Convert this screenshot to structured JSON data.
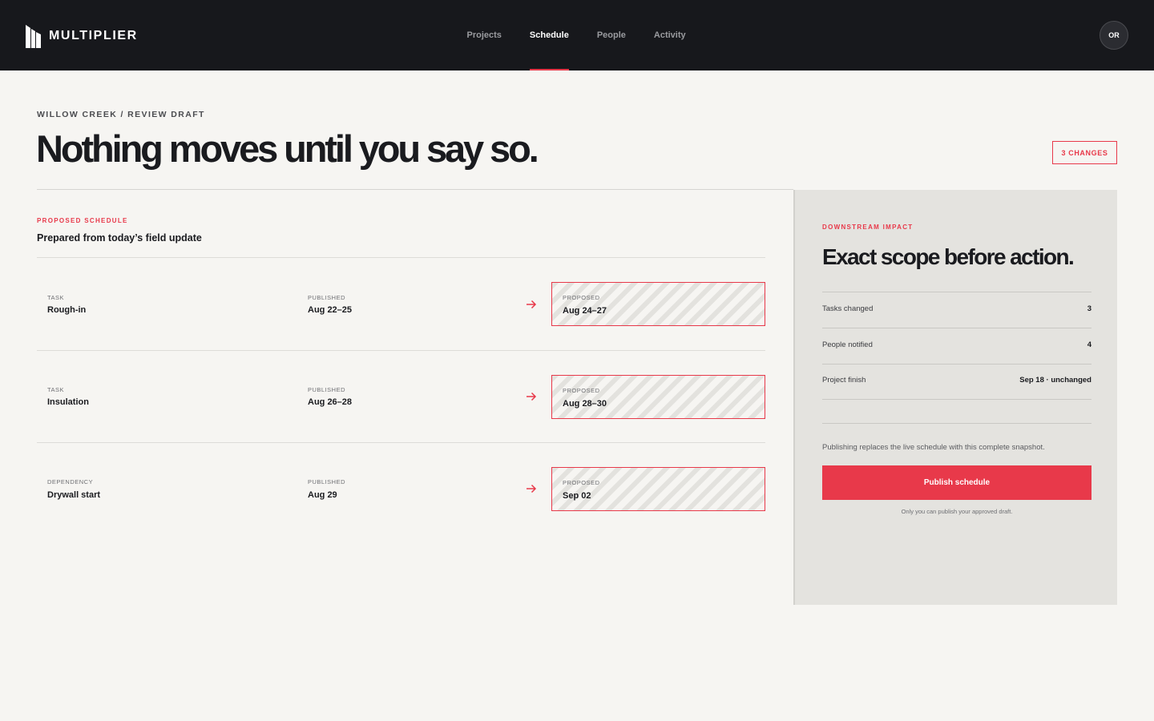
{
  "app": {
    "brand_name": "MULTIPLIER",
    "nav": [
      {
        "label": "Projects",
        "active": false
      },
      {
        "label": "Schedule",
        "active": true
      },
      {
        "label": "People",
        "active": false
      },
      {
        "label": "Activity",
        "active": false
      }
    ],
    "avatar_initials": "OR"
  },
  "header": {
    "breadcrumb": "WILLOW CREEK / REVIEW DRAFT",
    "title": "Nothing moves until you say so.",
    "changes_badge": "3 CHANGES"
  },
  "schedule": {
    "eyebrow": "PROPOSED SCHEDULE",
    "title": "Prepared from today’s field update",
    "rows": [
      {
        "kind": "TASK",
        "name": "Rough-in",
        "published_label": "PUBLISHED",
        "published": "Aug 22–25",
        "proposed_label": "PROPOSED",
        "proposed": "Aug 24–27"
      },
      {
        "kind": "TASK",
        "name": "Insulation",
        "published_label": "PUBLISHED",
        "published": "Aug 26–28",
        "proposed_label": "PROPOSED",
        "proposed": "Aug 28–30"
      },
      {
        "kind": "DEPENDENCY",
        "name": "Drywall start",
        "published_label": "PUBLISHED",
        "published": "Aug 29",
        "proposed_label": "PROPOSED",
        "proposed": "Sep 02"
      }
    ]
  },
  "impact": {
    "eyebrow": "DOWNSTREAM IMPACT",
    "title": "Exact scope before action.",
    "stats": [
      {
        "label": "Tasks changed",
        "value": "3"
      },
      {
        "label": "People notified",
        "value": "4"
      },
      {
        "label": "Project finish",
        "value": "Sep 18 · unchanged"
      }
    ],
    "note": "Publishing replaces the live schedule with this complete snapshot.",
    "publish_label": "Publish schedule",
    "footnote": "Only you can publish your approved draft."
  },
  "colors": {
    "accent": "#e8394a",
    "topbar": "#17181c",
    "background": "#f6f5f2",
    "panel": "#e4e3df"
  }
}
